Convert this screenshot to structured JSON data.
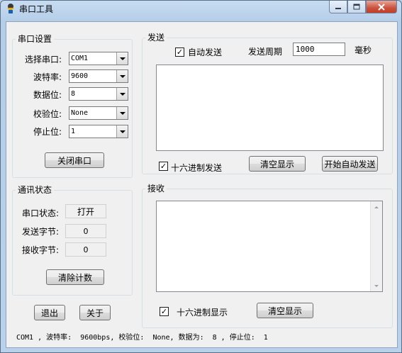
{
  "window": {
    "title": "串口工具",
    "icon": "app-icon",
    "controls": [
      "minimize-icon",
      "maximize-icon",
      "close-icon"
    ]
  },
  "port_settings": {
    "legend": "串口设置",
    "fields": [
      {
        "label": "选择串口:",
        "value": "COM1"
      },
      {
        "label": "波特率:",
        "value": "9600"
      },
      {
        "label": "数据位:",
        "value": "8"
      },
      {
        "label": "校验位:",
        "value": "None"
      },
      {
        "label": "停止位:",
        "value": "1"
      }
    ],
    "close_button": "关闭串口"
  },
  "comm_status": {
    "legend": "通讯状态",
    "rows": [
      {
        "label": "串口状态:",
        "value": "打开"
      },
      {
        "label": "发送字节:",
        "value": "0"
      },
      {
        "label": "接收字节:",
        "value": "0"
      }
    ],
    "clear_count_button": "清除计数"
  },
  "bottom_buttons": {
    "exit": "退出",
    "about": "关于"
  },
  "send": {
    "legend": "发送",
    "auto_send_label": "自动发送",
    "auto_send_checked": true,
    "period_label": "发送周期",
    "period_value": "1000",
    "period_unit": "毫秒",
    "hex_send_label": "十六进制发送",
    "hex_send_checked": true,
    "clear_button": "清空显示",
    "start_auto_button": "开始自动发送"
  },
  "receive": {
    "legend": "接收",
    "hex_display_label": "十六进制显示",
    "hex_display_checked": true,
    "clear_button": "清空显示"
  },
  "status_line": "COM1 , 波特率:  9600bps, 校验位:  None, 数据为:  8 , 停止位:  1"
}
